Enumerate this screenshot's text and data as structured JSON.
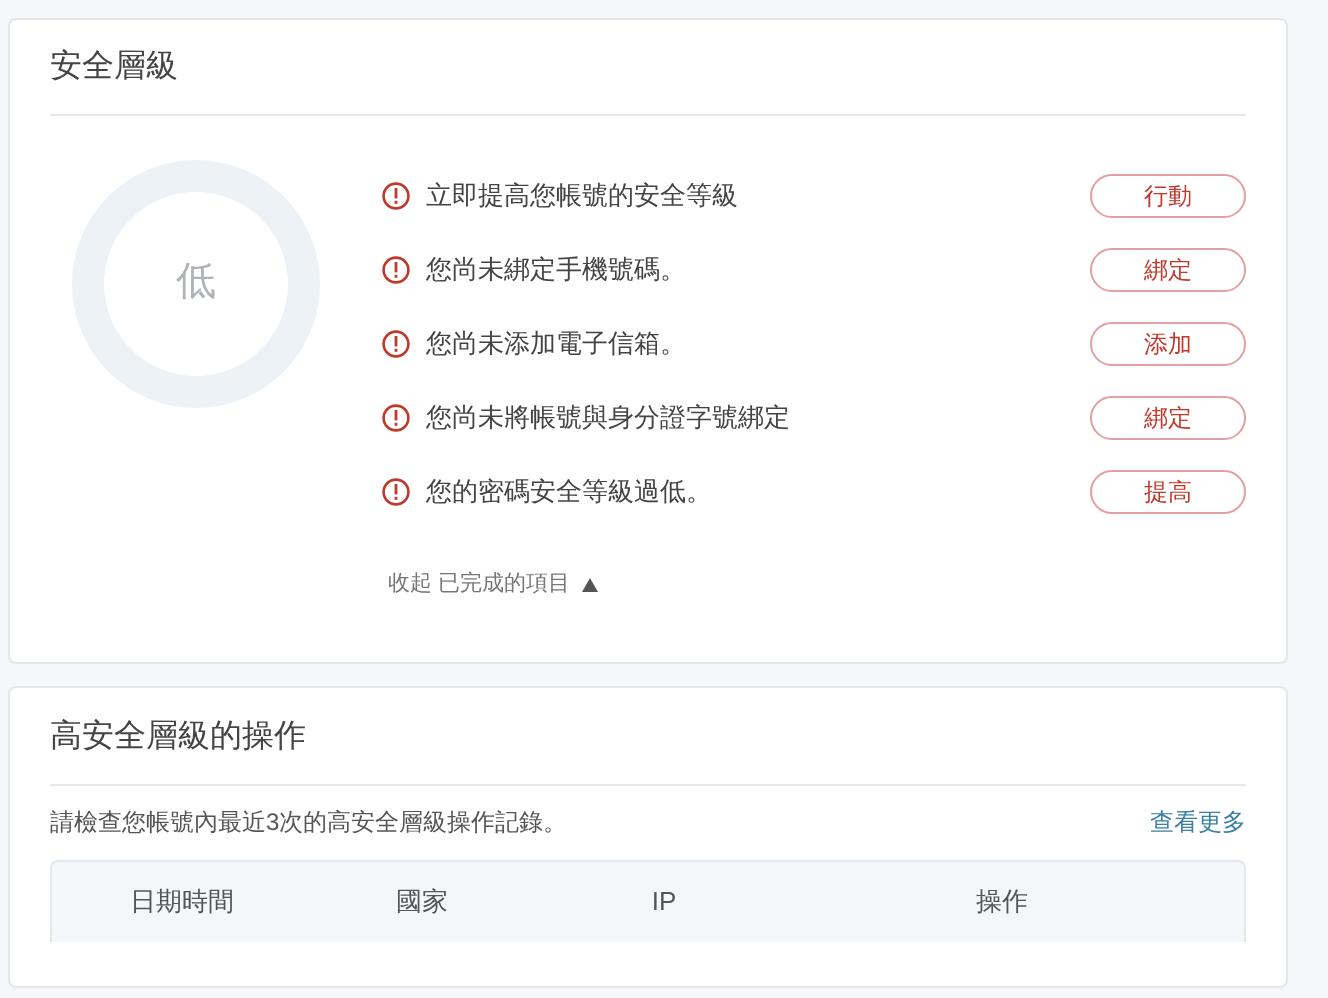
{
  "security_level": {
    "title": "安全層級",
    "rating": "低",
    "items": [
      {
        "text": "立即提高您帳號的安全等級",
        "action": "行動"
      },
      {
        "text": "您尚未綁定手機號碼。",
        "action": "綁定"
      },
      {
        "text": "您尚未添加電子信箱。",
        "action": "添加"
      },
      {
        "text": "您尚未將帳號與身分證字號綁定",
        "action": "綁定"
      },
      {
        "text": "您的密碼安全等級過低。",
        "action": "提高"
      }
    ],
    "toggle": "收起 已完成的項目"
  },
  "high_security_operations": {
    "title": "高安全層級的操作",
    "description": "請檢查您帳號內最近3次的高安全層級操作記錄。",
    "more_link": "查看更多",
    "table": {
      "columns": [
        "日期時間",
        "國家",
        "IP",
        "操作"
      ]
    }
  }
}
